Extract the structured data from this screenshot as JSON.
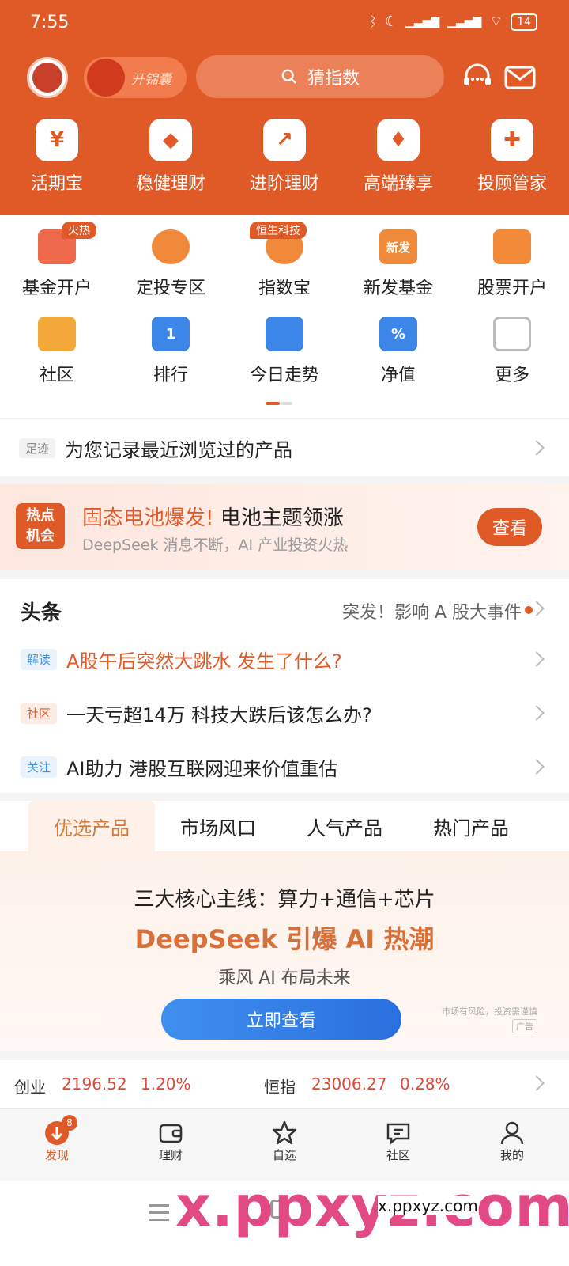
{
  "status": {
    "time": "7:55",
    "battery": "14",
    "icons": [
      "bluetooth-icon",
      "moon-icon",
      "signal-hd-icon",
      "signal-hd-icon",
      "wifi-icon"
    ]
  },
  "header": {
    "jinnang_label": "开锦囊",
    "search_placeholder": "猜指数"
  },
  "quick": [
    {
      "label": "活期宝",
      "glyph": "¥"
    },
    {
      "label": "稳健理财",
      "glyph": "◆"
    },
    {
      "label": "进阶理财",
      "glyph": "↗"
    },
    {
      "label": "高端臻享",
      "glyph": "♦"
    },
    {
      "label": "投顾管家",
      "glyph": "✚"
    }
  ],
  "grid": {
    "row1": [
      {
        "label": "基金开户",
        "tag": "火热",
        "color": "#ef6a4a"
      },
      {
        "label": "定投专区",
        "tag": "",
        "color": "#f08a3a"
      },
      {
        "label": "指数宝",
        "tag": "恒生科技",
        "color": "#f08a3a"
      },
      {
        "label": "新发基金",
        "tag": "",
        "color": "#ee8a3a",
        "glyph": "新发"
      },
      {
        "label": "股票开户",
        "tag": "",
        "color": "#f28a3a"
      }
    ],
    "row2": [
      {
        "label": "社区",
        "color": "#f2a93a"
      },
      {
        "label": "排行",
        "color": "#3b86e6",
        "glyph": "1"
      },
      {
        "label": "今日走势",
        "color": "#3b86e6"
      },
      {
        "label": "净值",
        "color": "#3b86e6",
        "glyph": "%"
      },
      {
        "label": "更多",
        "color": "#bbbbbb"
      }
    ]
  },
  "footprint": {
    "pill": "足迹",
    "text": "为您记录最近浏览过的产品"
  },
  "hot": {
    "badge_line1": "热点",
    "badge_line2": "机会",
    "highlight": "固态电池爆发!",
    "headline": " 电池主题领涨",
    "sub": "DeepSeek 消息不断，AI 产业投资火热",
    "button": "查看"
  },
  "news": {
    "title": "头条",
    "right_text": "突发！影响 A 股大事件",
    "items": [
      {
        "tag": "解读",
        "text": "A股午后突然大跳水 发生了什么?",
        "tag_color": "#4a90d9",
        "tag_bg": "#eaf3fc",
        "text_color": "#e05a28"
      },
      {
        "tag": "社区",
        "text": "一天亏超14万 科技大跌后该怎么办?",
        "tag_color": "#e05a28",
        "tag_bg": "#fcece6",
        "text_color": "#222222"
      },
      {
        "tag": "关注",
        "text": "AI助力 港股互联网迎来价值重估",
        "tag_color": "#4a90d9",
        "tag_bg": "#eaf3fc",
        "text_color": "#222222"
      }
    ]
  },
  "tabs": [
    "优选产品",
    "市场风口",
    "人气产品",
    "热门产品"
  ],
  "promo": {
    "line1": "三大核心主线：算力+通信+芯片",
    "line2": "DeepSeek 引爆 AI 热潮",
    "line3": "乘风 AI 布局未来",
    "button": "立即查看",
    "risk": "市场有风险，投资需谨慎",
    "ad": "广告"
  },
  "ticker": {
    "i1_name": "创业",
    "i1_value": "2196.52",
    "i1_change": "1.20%",
    "i2_name": "恒指",
    "i2_value": "23006.27",
    "i2_change": "0.28%"
  },
  "bottom_nav": {
    "items": [
      {
        "label": "发现",
        "badge": "8"
      },
      {
        "label": "理财"
      },
      {
        "label": "自选"
      },
      {
        "label": "社区"
      },
      {
        "label": "我的"
      }
    ]
  },
  "watermark": {
    "big": "x.ppxyz.com",
    "small": "x.ppxyz.com"
  },
  "colors": {
    "brand": "#e05a28",
    "blue": "#2a6fde",
    "up_red": "#d84a3a"
  }
}
